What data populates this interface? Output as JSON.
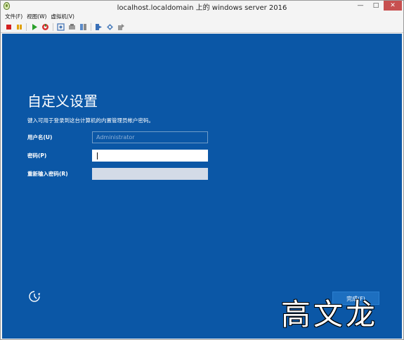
{
  "window": {
    "title": "localhost.localdomain 上的 windows server 2016",
    "minimize_glyph": "—",
    "maximize_glyph": "□",
    "close_glyph": "✕"
  },
  "menubar": {
    "items": [
      {
        "label": "文件(F)"
      },
      {
        "label": "视图(W)"
      },
      {
        "label": "虚拟机(V)"
      }
    ]
  },
  "toolbar": {
    "icons": [
      "stop-icon",
      "pause-icon",
      "play-icon",
      "reset-icon",
      "snapshot-icon",
      "revert-icon",
      "save-state-icon",
      "ctrl-alt-del-icon",
      "usb-icon",
      "settings-icon"
    ]
  },
  "setup": {
    "heading": "自定义设置",
    "instruction": "键入可用于登录到这台计算机的内置管理员帐户密码。",
    "username_label": "用户名(U)",
    "username_value": "Administrator",
    "password_label": "密码(P)",
    "repassword_label": "重新输入密码(R)",
    "finish_label": "完成(F)"
  },
  "watermark": "高文龙",
  "colors": {
    "screen_bg": "#0b57a6",
    "finish_bg": "#1d6fc0",
    "close_bg": "#c75050"
  }
}
